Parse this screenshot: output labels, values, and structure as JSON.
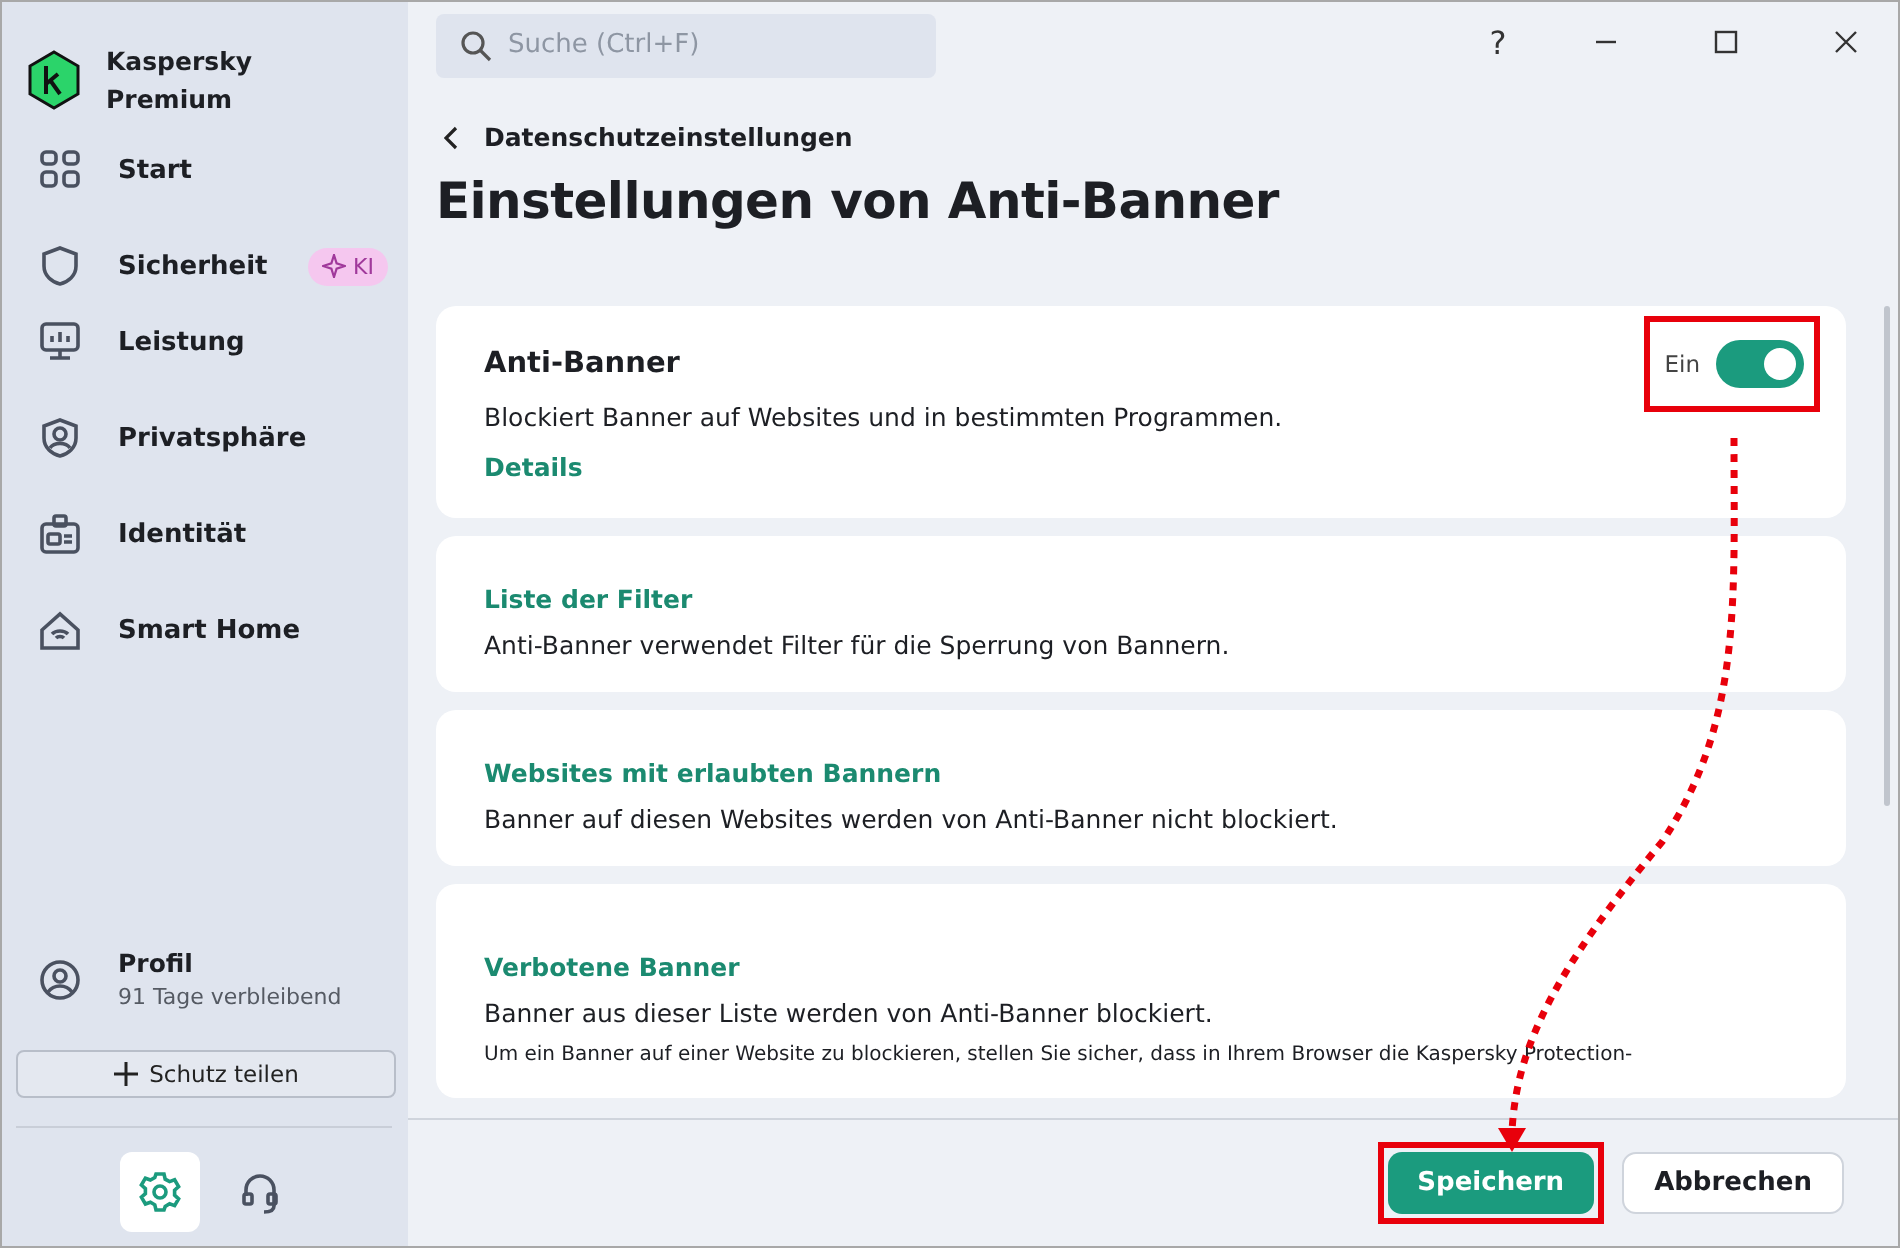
{
  "app_name": "Kaspersky Premium",
  "nav": [
    {
      "label": "Start",
      "kind": "grid"
    },
    {
      "label": "Sicherheit",
      "kind": "shield",
      "badge": "KI"
    },
    {
      "label": "Leistung",
      "kind": "monitor"
    },
    {
      "label": "Privatsphäre",
      "kind": "privacy"
    },
    {
      "label": "Identität",
      "kind": "id"
    },
    {
      "label": "Smart Home",
      "kind": "home"
    }
  ],
  "profile": {
    "label": "Profil",
    "subtitle": "91 Tage verbleibend"
  },
  "share_button": "Schutz teilen",
  "bottom_icons": [
    {
      "kind": "settings",
      "selected": true
    },
    {
      "kind": "support",
      "selected": false
    }
  ],
  "search": {
    "placeholder": "Suche (Ctrl+F)"
  },
  "help": "?",
  "breadcrumb": "Datenschutzeinstellungen",
  "title": "Einstellungen von Anti-Banner",
  "cards": [
    {
      "kind": "toggle",
      "title": "Anti-Banner",
      "description": "Blockiert Banner auf Websites und in bestimmten Programmen.",
      "link": "Details",
      "toggle": {
        "label": "Ein",
        "on": true
      }
    },
    {
      "kind": "link",
      "title": "Liste der Filter",
      "description": "Anti-Banner verwendet Filter für die Sperrung von Bannern."
    },
    {
      "kind": "link",
      "title": "Websites mit erlaubten Bannern",
      "description": "Banner auf diesen Websites werden von Anti-Banner nicht blockiert."
    },
    {
      "kind": "link",
      "title": "Verbotene Banner",
      "description": "Banner aus dieser Liste werden von Anti-Banner blockiert.",
      "note": "Um ein Banner auf einer Website zu blockieren, stellen Sie sicher, dass in Ihrem Browser die Kaspersky Protection-"
    }
  ],
  "buttons": [
    {
      "label": "Speichern",
      "kind": "primary"
    },
    {
      "label": "Abbrechen",
      "kind": "secondary"
    }
  ]
}
